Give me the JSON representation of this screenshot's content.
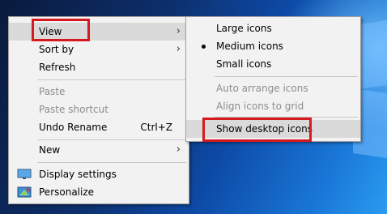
{
  "context_menu": {
    "items": [
      {
        "label": "View",
        "arrow": "›"
      },
      {
        "label": "Sort by",
        "arrow": "›"
      },
      {
        "label": "Refresh"
      },
      {
        "label": "Paste"
      },
      {
        "label": "Paste shortcut"
      },
      {
        "label": "Undo Rename",
        "shortcut": "Ctrl+Z"
      },
      {
        "label": "New",
        "arrow": "›"
      },
      {
        "label": "Display settings",
        "icon": "display-icon"
      },
      {
        "label": "Personalize",
        "icon": "personalize-icon"
      }
    ]
  },
  "view_submenu": {
    "items": [
      {
        "label": "Large icons"
      },
      {
        "label": "Medium icons",
        "selected": true
      },
      {
        "label": "Small icons"
      },
      {
        "label": "Auto arrange icons"
      },
      {
        "label": "Align icons to grid"
      },
      {
        "label": "Show desktop icons"
      }
    ]
  },
  "colors": {
    "menu_bg": "#f2f2f2",
    "highlight": "#dadada",
    "disabled_text": "#8c8c8c",
    "annotation_red": "#d8181f"
  }
}
